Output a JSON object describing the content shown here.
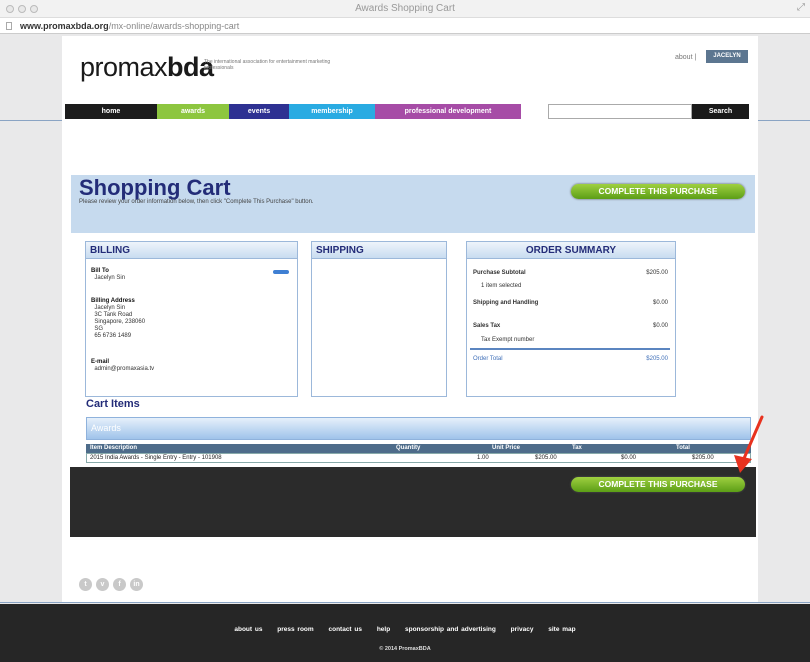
{
  "window": {
    "title": "Awards Shopping Cart"
  },
  "url": {
    "domain": "www.promaxbda.org",
    "path": "/mx-online/awards-shopping-cart"
  },
  "header": {
    "logo_light": "promax",
    "logo_bold": "bda",
    "tagline": "The international association for entertainment marketing professionals",
    "about_label": "about",
    "user_label": "JACELYN"
  },
  "nav": {
    "items": [
      {
        "label": "home",
        "color": "#1c1c1c"
      },
      {
        "label": "awards",
        "color": "#8dc63f"
      },
      {
        "label": "events",
        "color": "#2e3192"
      },
      {
        "label": "membership",
        "color": "#29abe2"
      },
      {
        "label": "professional development",
        "color": "#a64ca6"
      }
    ],
    "search_label": "Search"
  },
  "cart": {
    "title": "Shopping Cart",
    "instructions": "Please review your order information below, then click \"Complete This Purchase\" button.",
    "complete_label": "COMPLETE THIS PURCHASE"
  },
  "billing": {
    "title": "BILLING",
    "bill_to_label": "Bill To",
    "bill_to_name": "Jacelyn Sin",
    "address_label": "Billing Address",
    "address_lines": [
      "Jacelyn Sin",
      "3C Tank Road",
      "Singapore, 238060",
      "SG",
      "65 6736 1489"
    ],
    "email_label": "E-mail",
    "email": "admin@promaxasia.tv"
  },
  "shipping": {
    "title": "SHIPPING"
  },
  "summary": {
    "title": "ORDER SUMMARY",
    "subtotal_label": "Purchase Subtotal",
    "subtotal": "$205.00",
    "items_selected": "1 item selected",
    "shipping_label": "Shipping and Handling",
    "shipping": "$0.00",
    "tax_label": "Sales Tax",
    "tax": "$0.00",
    "tax_exempt": "Tax Exempt number",
    "total_label": "Order Total",
    "total": "$205.00"
  },
  "items": {
    "heading": "Cart Items",
    "group": "Awards",
    "columns": [
      "Item Description",
      "Quantity",
      "Unit Price",
      "Tax",
      "Total"
    ],
    "rows": [
      {
        "description": "2015 India Awards - Single Entry - Entry - 101908",
        "quantity": "1.00",
        "unit_price": "$205.00",
        "tax": "$0.00",
        "total": "$205.00"
      }
    ]
  },
  "footer": {
    "links": [
      "about us",
      "press room",
      "contact us",
      "help",
      "sponsorship and advertising",
      "privacy",
      "site map"
    ],
    "copyright": "© 2014 PromaxBDA"
  }
}
